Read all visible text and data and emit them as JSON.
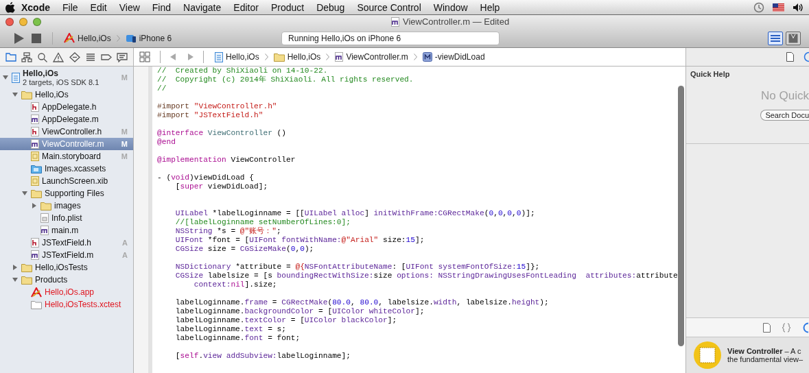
{
  "menu_bar": {
    "app_name": "Xcode",
    "items": [
      "File",
      "Edit",
      "View",
      "Find",
      "Navigate",
      "Editor",
      "Product",
      "Debug",
      "Source Control",
      "Window",
      "Help"
    ]
  },
  "window": {
    "title": "ViewController.m — Edited"
  },
  "toolbar": {
    "scheme": "Hello,iOs",
    "destination": "iPhone 6",
    "activity": "Running Hello,iOs on iPhone 6",
    "editor_modes": [
      {
        "kind": "standard",
        "selected": true
      },
      {
        "kind": "assistant",
        "selected": false
      }
    ]
  },
  "navigator_tabs": [
    {
      "kind": "project",
      "selected": true
    },
    {
      "kind": "symbol",
      "selected": false
    },
    {
      "kind": "find",
      "selected": false
    },
    {
      "kind": "issue",
      "selected": false
    },
    {
      "kind": "test",
      "selected": false
    },
    {
      "kind": "debug",
      "selected": false
    },
    {
      "kind": "breakpoint",
      "selected": false
    },
    {
      "kind": "report",
      "selected": false
    }
  ],
  "project": {
    "name": "Hello,iOs",
    "subtitle": "2 targets, iOS SDK 8.1",
    "badge": "M",
    "expanded": true,
    "children": [
      {
        "name": "Hello,iOs",
        "kind": "folder",
        "expanded": true,
        "selected": false,
        "missing": false,
        "children": [
          {
            "name": "AppDelegate.h",
            "kind": "header",
            "selected": false,
            "missing": false
          },
          {
            "name": "AppDelegate.m",
            "kind": "source",
            "selected": false,
            "missing": false
          },
          {
            "name": "ViewController.h",
            "kind": "header",
            "badge": "M",
            "selected": false,
            "missing": false
          },
          {
            "name": "ViewController.m",
            "kind": "source",
            "badge": "M",
            "selected": true,
            "missing": false
          },
          {
            "name": "Main.storyboard",
            "kind": "storyboard",
            "badge": "M",
            "selected": false,
            "missing": false
          },
          {
            "name": "Images.xcassets",
            "kind": "assets",
            "selected": false,
            "missing": false
          },
          {
            "name": "LaunchScreen.xib",
            "kind": "storyboard",
            "selected": false,
            "missing": false
          },
          {
            "name": "Supporting Files",
            "kind": "folder",
            "expanded": true,
            "selected": false,
            "missing": false,
            "children": [
              {
                "name": "images",
                "kind": "folder",
                "expanded": false,
                "selected": false,
                "missing": false
              },
              {
                "name": "Info.plist",
                "kind": "plist",
                "selected": false,
                "missing": false
              },
              {
                "name": "main.m",
                "kind": "source",
                "selected": false,
                "missing": false
              }
            ]
          },
          {
            "name": "JSTextField.h",
            "kind": "header",
            "badge": "A",
            "selected": false,
            "missing": false
          },
          {
            "name": "JSTextField.m",
            "kind": "source",
            "badge": "A",
            "selected": false,
            "missing": false
          }
        ]
      },
      {
        "name": "Hello,iOsTests",
        "kind": "folder",
        "expanded": false,
        "selected": false,
        "missing": false
      },
      {
        "name": "Products",
        "kind": "folder",
        "expanded": true,
        "selected": false,
        "missing": false,
        "children": [
          {
            "name": "Hello,iOs.app",
            "kind": "app",
            "selected": false,
            "missing": true
          },
          {
            "name": "Hello,iOsTests.xctest",
            "kind": "bundle",
            "selected": false,
            "missing": true
          }
        ]
      }
    ]
  },
  "jump_bar": [
    {
      "kind": "project",
      "text": "Hello,iOs"
    },
    {
      "kind": "folder",
      "text": "Hello,iOs"
    },
    {
      "kind": "source",
      "text": "ViewController.m"
    },
    {
      "kind": "method",
      "text": "-viewDidLoad"
    }
  ],
  "editor": {
    "lines": [
      {
        "kind": "code",
        "tokens": [
          {
            "kind": "comment",
            "text": "//  Created by ShiXiaoli on 14-10-22."
          }
        ]
      },
      {
        "kind": "code",
        "tokens": [
          {
            "kind": "comment",
            "text": "//  Copyright (c) 2014年 ShiXiaoli. All rights reserved."
          }
        ]
      },
      {
        "kind": "code",
        "tokens": [
          {
            "kind": "comment",
            "text": "//"
          }
        ]
      },
      {
        "kind": "blank"
      },
      {
        "kind": "code",
        "tokens": [
          {
            "kind": "preprocessor",
            "text": "#import "
          },
          {
            "kind": "string",
            "text": "\"ViewController.h\""
          }
        ]
      },
      {
        "kind": "code",
        "tokens": [
          {
            "kind": "preprocessor",
            "text": "#import "
          },
          {
            "kind": "string",
            "text": "\"JSTextField.h\""
          }
        ]
      },
      {
        "kind": "blank"
      },
      {
        "kind": "code",
        "tokens": [
          {
            "kind": "keyword",
            "text": "@interface"
          },
          {
            "kind": "project",
            "text": " ViewController"
          },
          {
            "kind": "plain",
            "text": " ()"
          }
        ]
      },
      {
        "kind": "code",
        "tokens": [
          {
            "kind": "keyword",
            "text": "@end"
          }
        ]
      },
      {
        "kind": "blank"
      },
      {
        "kind": "code",
        "tokens": [
          {
            "kind": "keyword",
            "text": "@implementation"
          },
          {
            "kind": "plain",
            "text": " ViewController"
          }
        ]
      },
      {
        "kind": "blank"
      },
      {
        "kind": "code",
        "tokens": [
          {
            "kind": "plain",
            "text": "- ("
          },
          {
            "kind": "keyword",
            "text": "void"
          },
          {
            "kind": "plain",
            "text": ")viewDidLoad {"
          }
        ]
      },
      {
        "kind": "indented",
        "tokens": [
          {
            "kind": "plain",
            "text": "["
          },
          {
            "kind": "keyword",
            "text": "super"
          },
          {
            "kind": "plain",
            "text": " viewDidLoad];"
          }
        ]
      },
      {
        "kind": "blank"
      },
      {
        "kind": "blank"
      },
      {
        "kind": "indented",
        "tokens": [
          {
            "kind": "class",
            "text": "UILabel"
          },
          {
            "kind": "plain",
            "text": " *labelLoginname = [["
          },
          {
            "kind": "class",
            "text": "UILabel"
          },
          {
            "kind": "class",
            "text": " alloc"
          },
          {
            "kind": "plain",
            "text": "] "
          },
          {
            "kind": "class",
            "text": "initWithFrame:CGRectMake"
          },
          {
            "kind": "plain",
            "text": "("
          },
          {
            "kind": "number",
            "text": "0"
          },
          {
            "kind": "plain",
            "text": ","
          },
          {
            "kind": "number",
            "text": "0"
          },
          {
            "kind": "plain",
            "text": ","
          },
          {
            "kind": "number",
            "text": "0"
          },
          {
            "kind": "plain",
            "text": ","
          },
          {
            "kind": "number",
            "text": "0"
          },
          {
            "kind": "plain",
            "text": ")];"
          }
        ]
      },
      {
        "kind": "indented",
        "tokens": [
          {
            "kind": "comment",
            "text": "//[labelLoginname setNumberOfLines:0];"
          }
        ]
      },
      {
        "kind": "indented",
        "tokens": [
          {
            "kind": "class",
            "text": "NSString"
          },
          {
            "kind": "plain",
            "text": " *s = "
          },
          {
            "kind": "string",
            "text": "@\"账号：\""
          },
          {
            "kind": "plain",
            "text": ";"
          }
        ]
      },
      {
        "kind": "indented",
        "tokens": [
          {
            "kind": "class",
            "text": "UIFont"
          },
          {
            "kind": "plain",
            "text": " *font = ["
          },
          {
            "kind": "class",
            "text": "UIFont"
          },
          {
            "kind": "class",
            "text": " fontWithName:"
          },
          {
            "kind": "string",
            "text": "@\"Arial\""
          },
          {
            "kind": "plain",
            "text": " size:"
          },
          {
            "kind": "number",
            "text": "15"
          },
          {
            "kind": "plain",
            "text": "];"
          }
        ]
      },
      {
        "kind": "indented",
        "tokens": [
          {
            "kind": "class",
            "text": "CGSize"
          },
          {
            "kind": "plain",
            "text": " size = "
          },
          {
            "kind": "class",
            "text": "CGSizeMake"
          },
          {
            "kind": "plain",
            "text": "("
          },
          {
            "kind": "number",
            "text": "0"
          },
          {
            "kind": "plain",
            "text": ","
          },
          {
            "kind": "number",
            "text": "0"
          },
          {
            "kind": "plain",
            "text": ");"
          }
        ]
      },
      {
        "kind": "blank"
      },
      {
        "kind": "indented",
        "tokens": [
          {
            "kind": "class",
            "text": "NSDictionary"
          },
          {
            "kind": "plain",
            "text": " *attribute = "
          },
          {
            "kind": "string",
            "text": "@{"
          },
          {
            "kind": "class",
            "text": "NSFontAttributeName"
          },
          {
            "kind": "plain",
            "text": ": ["
          },
          {
            "kind": "class",
            "text": "UIFont"
          },
          {
            "kind": "class",
            "text": " systemFontOfSize:"
          },
          {
            "kind": "number",
            "text": "15"
          },
          {
            "kind": "plain",
            "text": "]};"
          }
        ]
      },
      {
        "kind": "indented",
        "tokens": [
          {
            "kind": "class",
            "text": "CGSize"
          },
          {
            "kind": "plain",
            "text": " labelsize = [s "
          },
          {
            "kind": "class",
            "text": "boundingRectWithSize:"
          },
          {
            "kind": "plain",
            "text": "size "
          },
          {
            "kind": "class",
            "text": "options:"
          },
          {
            "kind": "class",
            "text": " NSStringDrawingUsesFontLeading"
          },
          {
            "kind": "class",
            "text": "  attributes:"
          },
          {
            "kind": "plain",
            "text": "attribute"
          }
        ]
      },
      {
        "kind": "continued",
        "tokens": [
          {
            "kind": "class",
            "text": "context:"
          },
          {
            "kind": "keyword",
            "text": "nil"
          },
          {
            "kind": "plain",
            "text": "].size;"
          }
        ]
      },
      {
        "kind": "blank"
      },
      {
        "kind": "indented",
        "tokens": [
          {
            "kind": "plain",
            "text": "labelLoginname."
          },
          {
            "kind": "class",
            "text": "frame"
          },
          {
            "kind": "plain",
            "text": " = "
          },
          {
            "kind": "class",
            "text": "CGRectMake"
          },
          {
            "kind": "plain",
            "text": "("
          },
          {
            "kind": "number",
            "text": "80.0"
          },
          {
            "kind": "plain",
            "text": ", "
          },
          {
            "kind": "number",
            "text": "80.0"
          },
          {
            "kind": "plain",
            "text": ", labelsize."
          },
          {
            "kind": "class",
            "text": "width"
          },
          {
            "kind": "plain",
            "text": ", labelsize."
          },
          {
            "kind": "class",
            "text": "height"
          },
          {
            "kind": "plain",
            "text": ");"
          }
        ]
      },
      {
        "kind": "indented",
        "tokens": [
          {
            "kind": "plain",
            "text": "labelLoginname."
          },
          {
            "kind": "class",
            "text": "backgroundColor"
          },
          {
            "kind": "plain",
            "text": " = ["
          },
          {
            "kind": "class",
            "text": "UIColor"
          },
          {
            "kind": "class",
            "text": " whiteColor"
          },
          {
            "kind": "plain",
            "text": "];"
          }
        ]
      },
      {
        "kind": "indented",
        "tokens": [
          {
            "kind": "plain",
            "text": "labelLoginname."
          },
          {
            "kind": "class",
            "text": "textColor"
          },
          {
            "kind": "plain",
            "text": " = ["
          },
          {
            "kind": "class",
            "text": "UIColor"
          },
          {
            "kind": "class",
            "text": " blackColor"
          },
          {
            "kind": "plain",
            "text": "];"
          }
        ]
      },
      {
        "kind": "indented",
        "tokens": [
          {
            "kind": "plain",
            "text": "labelLoginname."
          },
          {
            "kind": "class",
            "text": "text"
          },
          {
            "kind": "plain",
            "text": " = s;"
          }
        ]
      },
      {
        "kind": "indented",
        "tokens": [
          {
            "kind": "plain",
            "text": "labelLoginname."
          },
          {
            "kind": "class",
            "text": "font"
          },
          {
            "kind": "plain",
            "text": " = font;"
          }
        ]
      },
      {
        "kind": "blank"
      },
      {
        "kind": "indented",
        "tokens": [
          {
            "kind": "plain",
            "text": "["
          },
          {
            "kind": "keyword",
            "text": "self"
          },
          {
            "kind": "plain",
            "text": "."
          },
          {
            "kind": "class",
            "text": "view"
          },
          {
            "kind": "class",
            "text": " addSubview:"
          },
          {
            "kind": "plain",
            "text": "labelLoginname];"
          }
        ]
      }
    ]
  },
  "inspector": {
    "title": "Quick Help",
    "empty_message": "No Quick",
    "search_button": "Search Docu",
    "library_tabs": [
      {
        "kind": "file",
        "selected": false
      },
      {
        "kind": "code",
        "selected": false
      },
      {
        "kind": "object",
        "selected": true
      }
    ],
    "library_item": {
      "title": "View Controller",
      "summary": "– A c",
      "detail": "the fundamental view–"
    }
  }
}
